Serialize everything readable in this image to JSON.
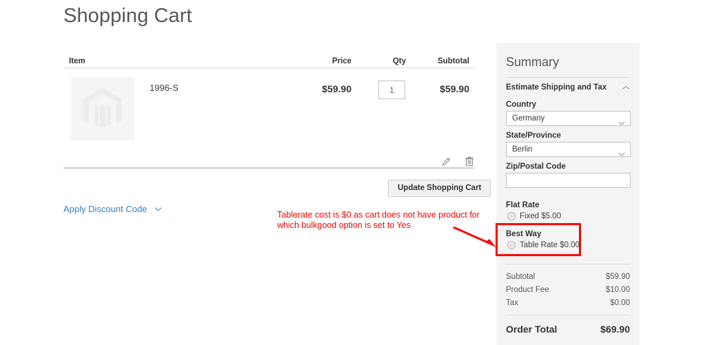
{
  "page": {
    "title": "Shopping Cart"
  },
  "cart": {
    "columns": {
      "item": "Item",
      "price": "Price",
      "qty": "Qty",
      "subtotal": "Subtotal"
    },
    "items": [
      {
        "name": "1996-S",
        "price": "$59.90",
        "qty": "1",
        "subtotal": "$59.90",
        "thumb_icon": "magento-placeholder-icon",
        "edit_icon": "pencil-icon",
        "remove_icon": "trash-icon"
      }
    ],
    "update_button": "Update Shopping Cart",
    "discount_link": "Apply Discount Code",
    "discount_chevron_icon": "chevron-down-icon"
  },
  "summary": {
    "title": "Summary",
    "estimate_section": {
      "heading": "Estimate Shipping and Tax",
      "toggle_icon": "chevron-up-icon",
      "country_label": "Country",
      "country_value": "Germany",
      "country_chevron_icon": "chevron-down-icon",
      "state_label": "State/Province",
      "state_value": "Berlin",
      "state_chevron_icon": "chevron-down-icon",
      "zip_label": "Zip/Postal Code",
      "zip_value": "",
      "zip_placeholder": ""
    },
    "shipping_methods": [
      {
        "carrier": "Flat Rate",
        "option_label": "Fixed $5.00",
        "selected": false
      },
      {
        "carrier": "Best Way",
        "option_label": "Table Rate $0.00",
        "selected": false
      }
    ],
    "totals": [
      {
        "label": "Subtotal",
        "value": "$59.90"
      },
      {
        "label": "Product Fee",
        "value": "$10.00"
      },
      {
        "label": "Tax",
        "value": "$0.00"
      }
    ],
    "grand_total": {
      "label": "Order Total",
      "value": "$69.90"
    }
  },
  "annotation": {
    "text": "Tablerate cost is $0 as cart does not have product for which bulkgood option is set to Yes",
    "color": "#ff0000",
    "arrow_icon": "red-arrow-icon",
    "highlight_icon": "red-highlight-box"
  }
}
